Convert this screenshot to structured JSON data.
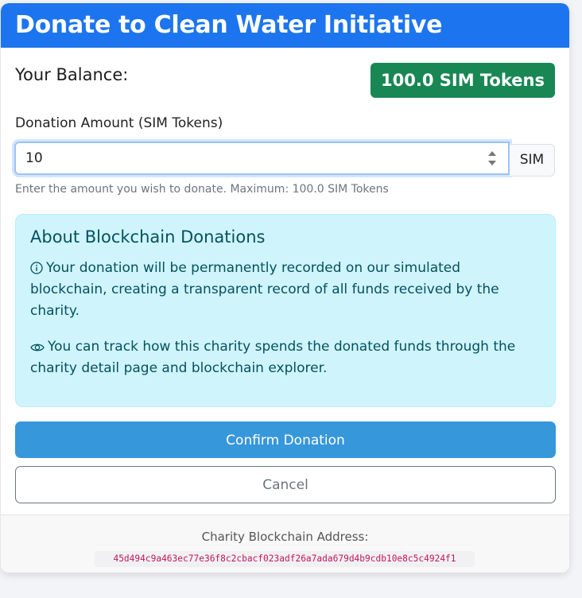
{
  "header": {
    "title": "Donate to Clean Water Initiative",
    "background_color": "#1c75ef"
  },
  "balance": {
    "label": "Your Balance:",
    "value": "100.0 SIM Tokens",
    "badge_color": "#198754"
  },
  "donation": {
    "label": "Donation Amount (SIM Tokens)",
    "value": "10",
    "unit": "SIM",
    "help_text": "Enter the amount you wish to donate. Maximum: 100.0 SIM Tokens"
  },
  "info": {
    "title": "About Blockchain Donations",
    "paragraph_1": "Your donation will be permanently recorded on our simulated blockchain, creating a transparent record of all funds received by the charity.",
    "paragraph_1_icon": "info-circle-icon",
    "paragraph_2": "You can track how this charity spends the donated funds through the charity detail page and blockchain explorer.",
    "paragraph_2_icon": "eye-icon",
    "background_color": "#cff4fc",
    "text_color": "#055160"
  },
  "actions": {
    "confirm_label": "Confirm Donation",
    "cancel_label": "Cancel",
    "confirm_color": "#3797db"
  },
  "footer": {
    "address_label": "Charity Blockchain Address:",
    "address": "45d494c9a463ec77e36f8c2cbacf023adf26a7ada679d4b9cdb10e8c5c4924f1",
    "address_color": "#c2185b"
  }
}
